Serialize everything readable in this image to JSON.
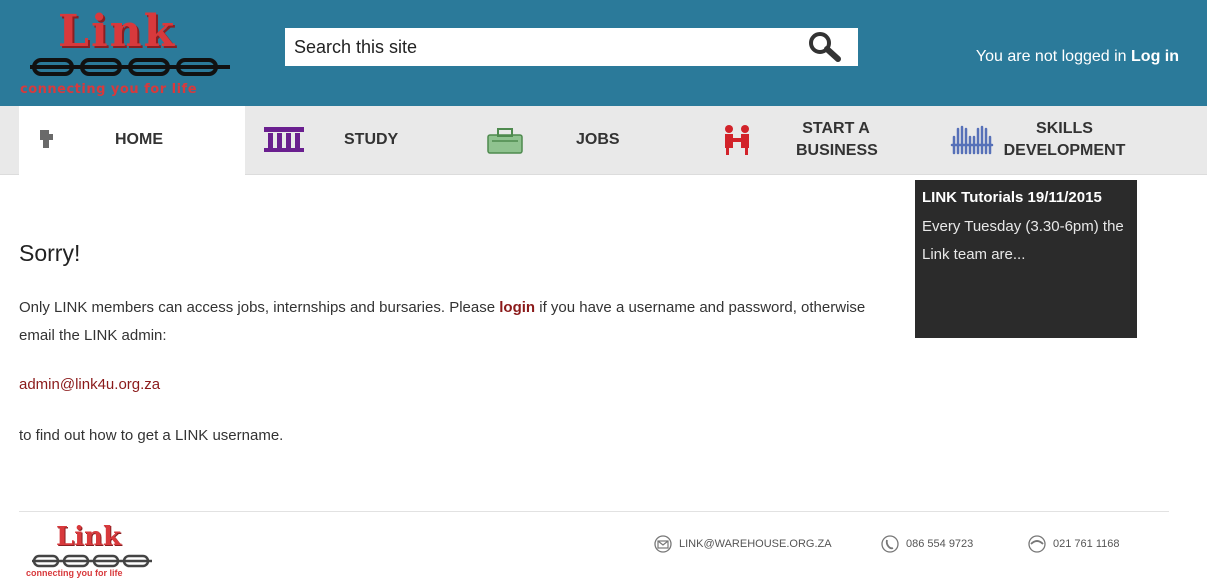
{
  "brand": {
    "logo_text": "Link",
    "tagline": "connecting you for life",
    "brand_color": "#d8393c"
  },
  "header": {
    "background": "#2b7a9a",
    "search": {
      "placeholder": "Search this site"
    },
    "login_status": "You are not logged in",
    "login_link": "Log in"
  },
  "nav": {
    "items": [
      {
        "label": "HOME",
        "icon": "home-icon"
      },
      {
        "label": "STUDY",
        "icon": "institution-icon"
      },
      {
        "label": "JOBS",
        "icon": "jobs-icon"
      },
      {
        "label_line1": "START A",
        "label_line2": "BUSINESS",
        "icon": "handshake-icon"
      },
      {
        "label_line1": "SKILLS",
        "label_line2": "DEVELOPMENT",
        "icon": "hands-icon"
      }
    ]
  },
  "main": {
    "title": "Sorry!",
    "para1_before": "Only LINK members can access jobs, internships and bursaries. Please ",
    "para1_link": "login",
    "para1_after": " if you have a username and password, otherwise email the LINK admin:",
    "email": "admin@link4u.org.za",
    "para3": "to find out how to get a LINK username."
  },
  "sidebar": {
    "title": "LINK Tutorials 19/11/2015",
    "text": "Every Tuesday (3.30-6pm) the Link team are..."
  },
  "footer": {
    "email": "LINK@WAREHOUSE.ORG.ZA",
    "phone": "086 554 9723",
    "fax": "021 761 1168"
  }
}
